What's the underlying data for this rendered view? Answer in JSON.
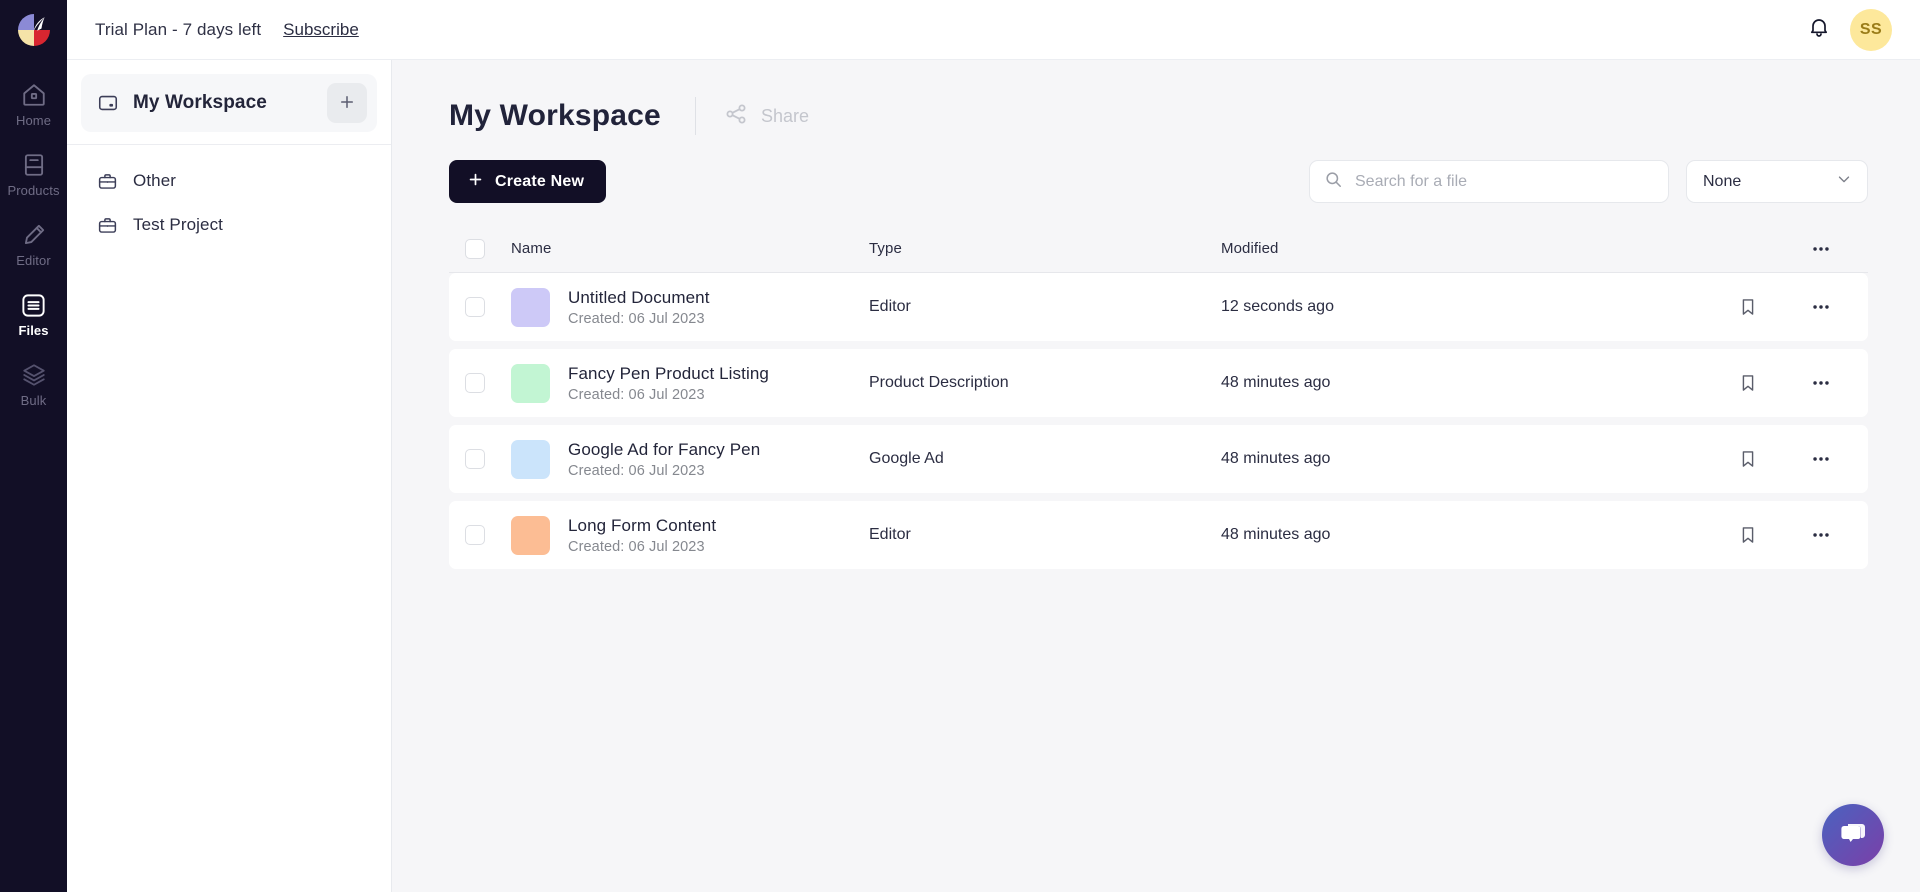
{
  "brand": {
    "logo_name": "writesonic-logo",
    "dark": "#120f26"
  },
  "rail": {
    "items": [
      {
        "label": "Home",
        "icon": "home-icon",
        "active": false
      },
      {
        "label": "Products",
        "icon": "book-icon",
        "active": false
      },
      {
        "label": "Editor",
        "icon": "pencil-icon",
        "active": false
      },
      {
        "label": "Files",
        "icon": "files-icon",
        "active": true
      },
      {
        "label": "Bulk",
        "icon": "layers-icon",
        "active": false
      }
    ]
  },
  "topbar": {
    "trial_text": "Trial Plan - 7 days left",
    "subscribe_label": "Subscribe",
    "bell_icon": "bell-icon",
    "avatar_initials": "SS",
    "avatar_bg": "#fde89b",
    "avatar_fg": "#9a7c18"
  },
  "workspace_panel": {
    "header_title": "My Workspace",
    "header_icon": "workspace-icon",
    "add_button_label": "+",
    "items": [
      {
        "label": "Other",
        "icon": "briefcase-icon"
      },
      {
        "label": "Test Project",
        "icon": "briefcase-icon"
      }
    ]
  },
  "main": {
    "title": "My Workspace",
    "share_label": "Share",
    "share_icon": "share-icon",
    "create_button_label": "Create New",
    "search": {
      "placeholder": "Search for a file",
      "value": "",
      "icon": "search-icon"
    },
    "filter": {
      "value": "None",
      "icon": "chevron-down-icon"
    },
    "table": {
      "columns": [
        "Name",
        "Type",
        "Modified"
      ],
      "header_menu_icon": "more-horizontal-icon",
      "rows": [
        {
          "name": "Untitled Document",
          "created": "Created: 06 Jul 2023",
          "type": "Editor",
          "modified": "12 seconds ago",
          "thumb_color": "#cdc9f7",
          "bookmark_icon": "bookmark-icon",
          "menu_icon": "more-horizontal-icon"
        },
        {
          "name": "Fancy Pen Product Listing",
          "created": "Created: 06 Jul 2023",
          "type": "Product Description",
          "modified": "48 minutes ago",
          "thumb_color": "#c2f5d3",
          "bookmark_icon": "bookmark-icon",
          "menu_icon": "more-horizontal-icon"
        },
        {
          "name": "Google Ad for Fancy Pen",
          "created": "Created: 06 Jul 2023",
          "type": "Google Ad",
          "modified": "48 minutes ago",
          "thumb_color": "#cbe4fb",
          "bookmark_icon": "bookmark-icon",
          "menu_icon": "more-horizontal-icon"
        },
        {
          "name": "Long Form Content",
          "created": "Created: 06 Jul 2023",
          "type": "Editor",
          "modified": "48 minutes ago",
          "thumb_color": "#fcbd94",
          "bookmark_icon": "bookmark-icon",
          "menu_icon": "more-horizontal-icon"
        }
      ]
    },
    "chat_fab_icon": "chat-bubble-icon"
  }
}
